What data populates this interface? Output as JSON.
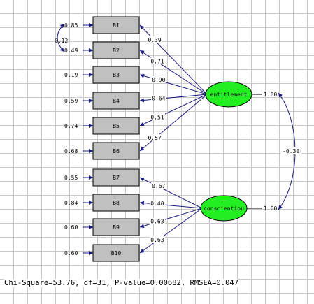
{
  "observed": [
    {
      "label": "B1",
      "error": "0.85"
    },
    {
      "label": "B2",
      "error": "0.49"
    },
    {
      "label": "B3",
      "error": "0.19"
    },
    {
      "label": "B4",
      "error": "0.59"
    },
    {
      "label": "B5",
      "error": "0.74"
    },
    {
      "label": "B6",
      "error": "0.68"
    },
    {
      "label": "B7",
      "error": "0.55"
    },
    {
      "label": "B8",
      "error": "0.84"
    },
    {
      "label": "B9",
      "error": "0.60"
    },
    {
      "label": "B10",
      "error": "0.60"
    }
  ],
  "latent": [
    {
      "label": "entitlement",
      "variance": "1.00"
    },
    {
      "label": "conscientiou",
      "variance": "1.00"
    }
  ],
  "loadings": [
    {
      "latent": 0,
      "indicator": 0,
      "value": "0.39"
    },
    {
      "latent": 0,
      "indicator": 1,
      "value": "0.71"
    },
    {
      "latent": 0,
      "indicator": 2,
      "value": "0.90"
    },
    {
      "latent": 0,
      "indicator": 3,
      "value": "0.64"
    },
    {
      "latent": 0,
      "indicator": 4,
      "value": "0.51"
    },
    {
      "latent": 0,
      "indicator": 5,
      "value": "0.57"
    },
    {
      "latent": 1,
      "indicator": 6,
      "value": "0.67"
    },
    {
      "latent": 1,
      "indicator": 7,
      "value": "0.40"
    },
    {
      "latent": 1,
      "indicator": 8,
      "value": "0.63"
    },
    {
      "latent": 1,
      "indicator": 9,
      "value": "0.63"
    }
  ],
  "error_covariance": {
    "between": [
      0,
      1
    ],
    "value": "0.12"
  },
  "factor_correlation": "-0.30",
  "fit": "Chi-Square=53.76, df=31, P-value=0.00682, RMSEA=0.047",
  "colors": {
    "box_fill": "#c0c0c0",
    "latent_fill": "#22ee22",
    "arrow": "#1a1a80"
  }
}
